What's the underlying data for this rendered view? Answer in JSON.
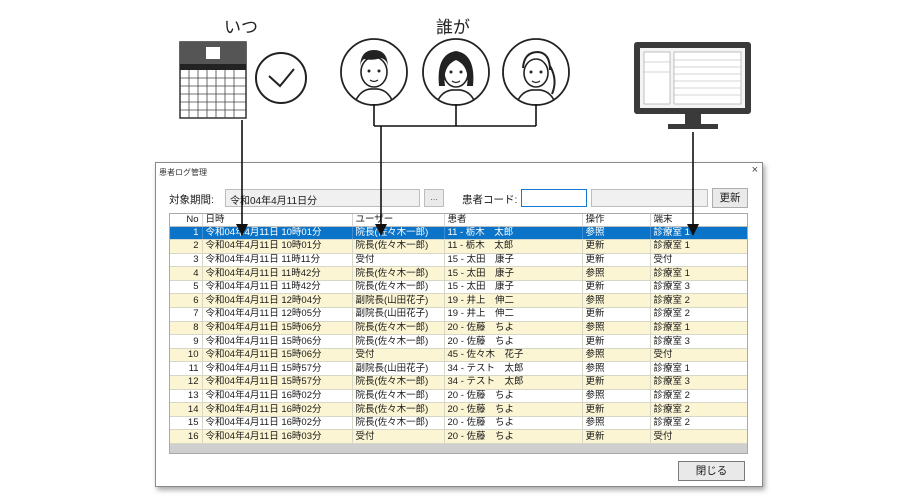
{
  "captions": {
    "when": "いつ",
    "who": "誰が"
  },
  "window": {
    "title": "患者ログ管理",
    "close_symbol": "×"
  },
  "filter": {
    "period_label": "対象期間:",
    "period_value": "令和04年4月11日分",
    "dots_label": "...",
    "patient_code_label": "患者コード:",
    "patient_code_value": "",
    "patient_name_value": "",
    "update_label": "更新"
  },
  "table": {
    "columns": [
      "No",
      "日時",
      "ユーザー",
      "患者",
      "操作",
      "端末"
    ],
    "selected_row": 1,
    "rows": [
      [
        "1",
        "令和04年4月11日 10時01分",
        "院長(佐々木一郎)",
        "11 - 栃木　太郎",
        "参照",
        "診療室 1"
      ],
      [
        "2",
        "令和04年4月11日 10時01分",
        "院長(佐々木一郎)",
        "11 - 栃木　太郎",
        "更新",
        "診療室 1"
      ],
      [
        "3",
        "令和04年4月11日 11時11分",
        "受付",
        "15 - 太田　康子",
        "更新",
        "受付"
      ],
      [
        "4",
        "令和04年4月11日 11時42分",
        "院長(佐々木一郎)",
        "15 - 太田　康子",
        "参照",
        "診療室 1"
      ],
      [
        "5",
        "令和04年4月11日 11時42分",
        "院長(佐々木一郎)",
        "15 - 太田　康子",
        "更新",
        "診療室 3"
      ],
      [
        "6",
        "令和04年4月11日 12時04分",
        "副院長(山田花子)",
        "19 - 井上　伸二",
        "参照",
        "診療室 2"
      ],
      [
        "7",
        "令和04年4月11日 12時05分",
        "副院長(山田花子)",
        "19 - 井上　伸二",
        "更新",
        "診療室 2"
      ],
      [
        "8",
        "令和04年4月11日 15時06分",
        "院長(佐々木一郎)",
        "20 - 佐藤　ちよ",
        "参照",
        "診療室 1"
      ],
      [
        "9",
        "令和04年4月11日 15時06分",
        "院長(佐々木一郎)",
        "20 - 佐藤　ちよ",
        "更新",
        "診療室 3"
      ],
      [
        "10",
        "令和04年4月11日 15時06分",
        "受付",
        "45 - 佐々木　花子",
        "参照",
        "受付"
      ],
      [
        "11",
        "令和04年4月11日 15時57分",
        "副院長(山田花子)",
        "34 - テスト　太郎",
        "参照",
        "診療室 1"
      ],
      [
        "12",
        "令和04年4月11日 15時57分",
        "院長(佐々木一郎)",
        "34 - テスト　太郎",
        "更新",
        "診療室 3"
      ],
      [
        "13",
        "令和04年4月11日 16時02分",
        "院長(佐々木一郎)",
        "20 - 佐藤　ちよ",
        "参照",
        "診療室 2"
      ],
      [
        "14",
        "令和04年4月11日 16時02分",
        "院長(佐々木一郎)",
        "20 - 佐藤　ちよ",
        "更新",
        "診療室 2"
      ],
      [
        "15",
        "令和04年4月11日 16時02分",
        "院長(佐々木一郎)",
        "20 - 佐藤　ちよ",
        "参照",
        "診療室 2"
      ],
      [
        "16",
        "令和04年4月11日 16時03分",
        "受付",
        "20 - 佐藤　ちよ",
        "更新",
        "受付"
      ]
    ]
  },
  "close_button": "閉じる",
  "colors": {
    "selection": "#0c74c8",
    "stripe": "#fbf5d3",
    "focus_border": "#1677d2"
  }
}
